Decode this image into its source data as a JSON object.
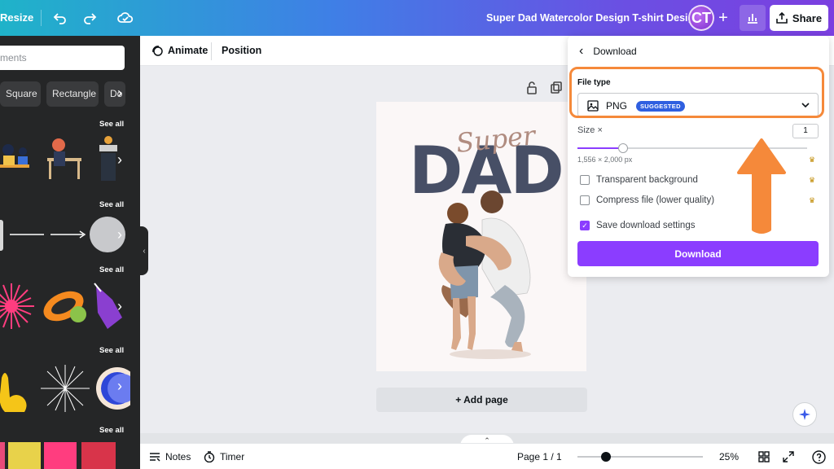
{
  "topbar": {
    "resize_label": "Resize",
    "doc_title": "Super Dad Watercolor Design T-shirt Design",
    "avatar_initials": "CT",
    "plus_label": "+",
    "share_label": "Share"
  },
  "sidebar": {
    "search_placeholder": "ments",
    "chips": [
      "Square",
      "Rectangle",
      "Do"
    ],
    "see_all": "See all"
  },
  "editor_toolbar": {
    "animate_label": "Animate",
    "position_label": "Position"
  },
  "canvas": {
    "design_text_script": "Super",
    "design_text_bold": "DAD",
    "add_page_label": "+ Add page"
  },
  "download_panel": {
    "header": "Download",
    "file_type_label": "File type",
    "file_type_value": "PNG",
    "suggested_badge": "SUGGESTED",
    "size_label": "Size ×",
    "size_value": "1",
    "size_fraction": 0.2,
    "dimensions": "1,556 × 2,000 px",
    "transparent_label": "Transparent background",
    "compress_label": "Compress file (lower quality)",
    "save_settings_label": "Save download settings",
    "save_settings_checked": true,
    "download_button": "Download"
  },
  "bottombar": {
    "notes_label": "Notes",
    "timer_label": "Timer",
    "page_indicator": "Page 1 / 1",
    "zoom_level": "25%",
    "zoom_fraction": 0.23
  },
  "colors": {
    "accent": "#8b3dff",
    "annotation": "#f5893a",
    "dad_text": "#474f66"
  }
}
